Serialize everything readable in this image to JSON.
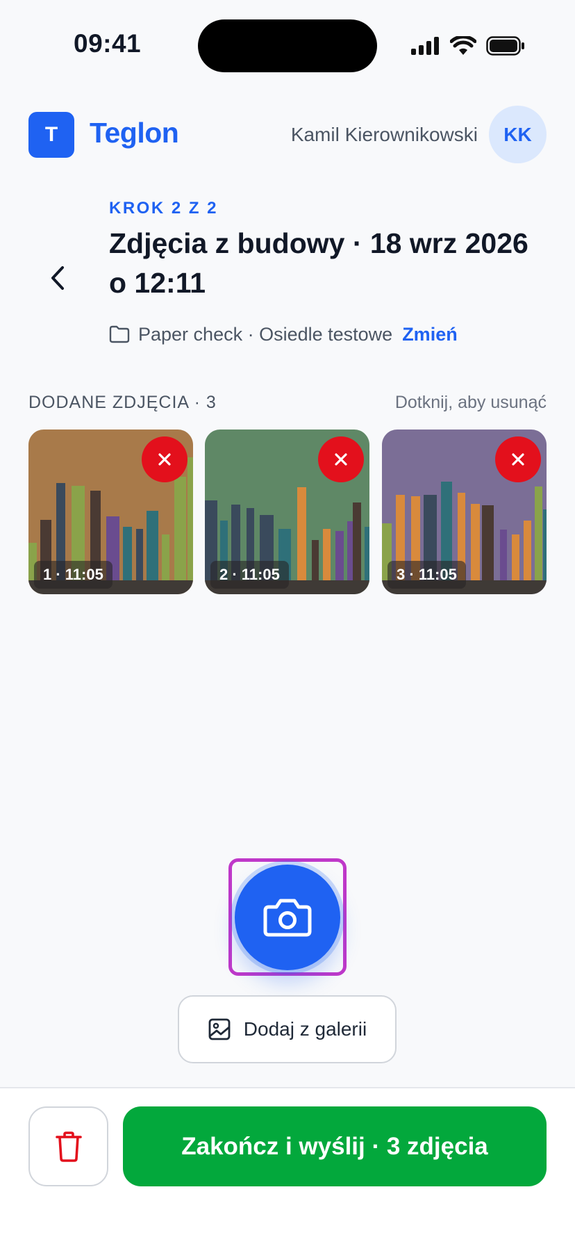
{
  "status_bar": {
    "time": "09:41"
  },
  "header": {
    "logo_letter": "T",
    "app_name": "Teglon",
    "user_name": "Kamil Kierownikowski",
    "avatar_initials": "KK"
  },
  "step": {
    "label": "KROK 2 Z 2",
    "title": "Zdjęcia z budowy · 18 wrz 2026 o 12:11",
    "project": "Paper check · Osiedle testowe",
    "change_link": "Zmień"
  },
  "photos": {
    "title": "DODANE ZDJĘCIA · 3",
    "hint": "Dotknij, aby usunąć",
    "items": [
      {
        "label": "1 · 11:05",
        "bg": "#a87a4a"
      },
      {
        "label": "2 · 11:05",
        "bg": "#5f8866"
      },
      {
        "label": "3 · 11:05",
        "bg": "#7b6e96"
      }
    ]
  },
  "actions": {
    "gallery_label": "Dodaj z galerii",
    "submit_label": "Zakończ i wyślij · 3 zdjęcia"
  },
  "colors": {
    "accent": "#1f62f2",
    "success": "#03a83c",
    "danger": "#e3101c"
  }
}
